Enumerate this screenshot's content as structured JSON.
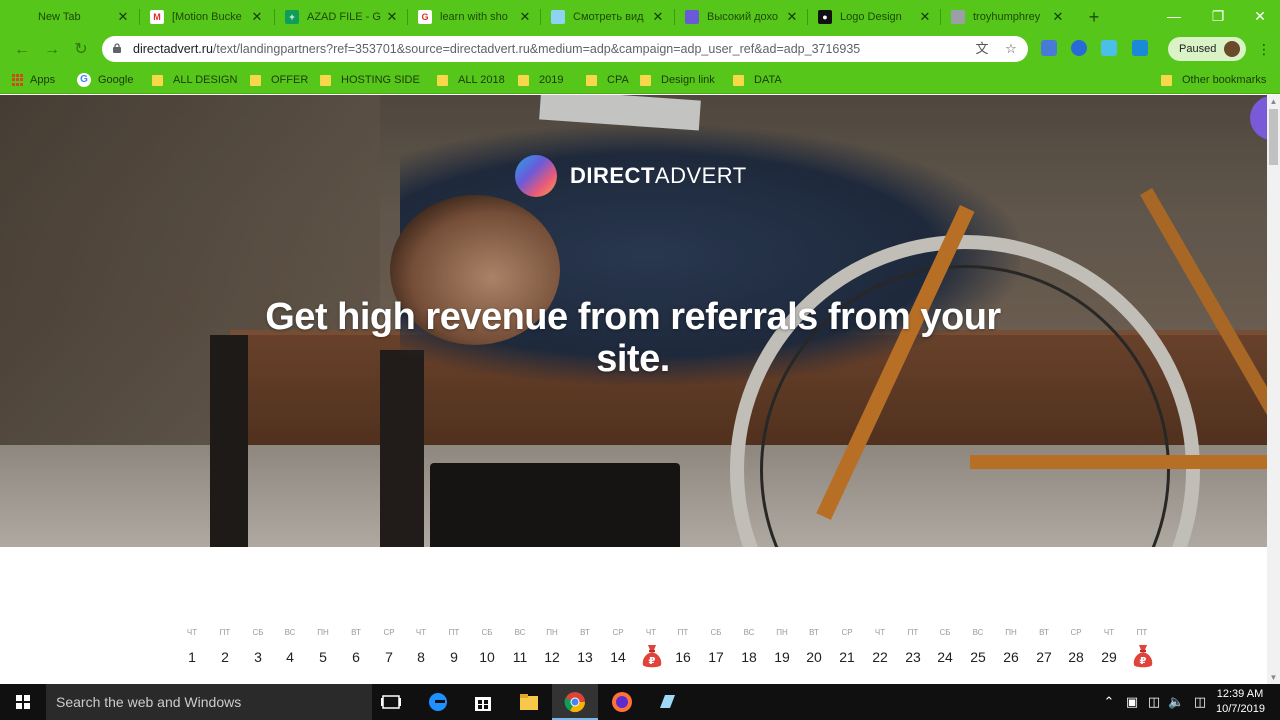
{
  "browser": {
    "tabs": [
      {
        "title": "New Tab",
        "favicon_color": "#56c61a",
        "favicon": ""
      },
      {
        "title": "[Motion Bucke",
        "favicon_color": "#ffffff",
        "favicon": "M"
      },
      {
        "title": "AZAD FILE - G",
        "favicon_color": "#0f9d58",
        "favicon": "+"
      },
      {
        "title": "learn with sho",
        "favicon_color": "#ffffff",
        "favicon": "G"
      },
      {
        "title": "Смотреть вид",
        "favicon_color": "#8fd3f4",
        "favicon": ""
      },
      {
        "title": "Высокий дохо",
        "favicon_color": "#6a5ad8",
        "favicon": ""
      },
      {
        "title": "Logo Design",
        "favicon_color": "#111111",
        "favicon": "●"
      },
      {
        "title": "troyhumphrey",
        "favicon_color": "#9aa0a6",
        "favicon": ""
      }
    ],
    "new_tab_symbol": "+",
    "window_controls": {
      "minimize": "—",
      "maximize": "❐",
      "close": "✕"
    },
    "url": {
      "host": "directadvert.ru",
      "path": "/text/landingpartners?ref=353701&source=directadvert.ru&medium=adp&campaign=adp_user_ref&ad=adp_3716935"
    },
    "profile_status": "Paused",
    "bookmarks": [
      {
        "label": "Apps",
        "kind": "apps"
      },
      {
        "label": "Google",
        "kind": "google"
      },
      {
        "label": "ALL DESIGN",
        "kind": "folder"
      },
      {
        "label": "OFFER",
        "kind": "folder"
      },
      {
        "label": "HOSTING  SIDE",
        "kind": "folder"
      },
      {
        "label": "ALL 2018",
        "kind": "folder"
      },
      {
        "label": "2019",
        "kind": "folder"
      },
      {
        "label": "CPA",
        "kind": "folder"
      },
      {
        "label": "Design link",
        "kind": "folder"
      },
      {
        "label": "DATA",
        "kind": "folder"
      }
    ],
    "other_bookmarks": "Other bookmarks",
    "accent_color": "#56c61a"
  },
  "page": {
    "logo": {
      "bold": "DIRECT",
      "light": "ADVERT"
    },
    "headline_line1": "Get high revenue from referrals from your",
    "headline_line2": "site.",
    "calendar": [
      {
        "dw": "ЧТ",
        "dn": "1"
      },
      {
        "dw": "ПТ",
        "dn": "2"
      },
      {
        "dw": "СБ",
        "dn": "3"
      },
      {
        "dw": "ВС",
        "dn": "4"
      },
      {
        "dw": "ПН",
        "dn": "5"
      },
      {
        "dw": "ВТ",
        "dn": "6"
      },
      {
        "dw": "СР",
        "dn": "7"
      },
      {
        "dw": "ЧТ",
        "dn": "8"
      },
      {
        "dw": "ПТ",
        "dn": "9"
      },
      {
        "dw": "СБ",
        "dn": "10"
      },
      {
        "dw": "ВС",
        "dn": "11"
      },
      {
        "dw": "ПН",
        "dn": "12"
      },
      {
        "dw": "ВТ",
        "dn": "13"
      },
      {
        "dw": "СР",
        "dn": "14"
      },
      {
        "dw": "ЧТ",
        "dn": "",
        "payday": true
      },
      {
        "dw": "ПТ",
        "dn": "16"
      },
      {
        "dw": "СБ",
        "dn": "17"
      },
      {
        "dw": "ВС",
        "dn": "18"
      },
      {
        "dw": "ПН",
        "dn": "19"
      },
      {
        "dw": "ВТ",
        "dn": "20"
      },
      {
        "dw": "СР",
        "dn": "21"
      },
      {
        "dw": "ЧТ",
        "dn": "22"
      },
      {
        "dw": "ПТ",
        "dn": "23"
      },
      {
        "dw": "СБ",
        "dn": "24"
      },
      {
        "dw": "ВС",
        "dn": "25"
      },
      {
        "dw": "ПН",
        "dn": "26"
      },
      {
        "dw": "ВТ",
        "dn": "27"
      },
      {
        "dw": "СР",
        "dn": "28"
      },
      {
        "dw": "ЧТ",
        "dn": "29"
      },
      {
        "dw": "ПТ",
        "dn": "",
        "payday": true
      }
    ],
    "payday_icon": "money-bag-icon",
    "currency_symbol": "₽"
  },
  "taskbar": {
    "search_placeholder": "Search the web and Windows",
    "time": "12:39 AM",
    "date": "10/7/2019"
  }
}
